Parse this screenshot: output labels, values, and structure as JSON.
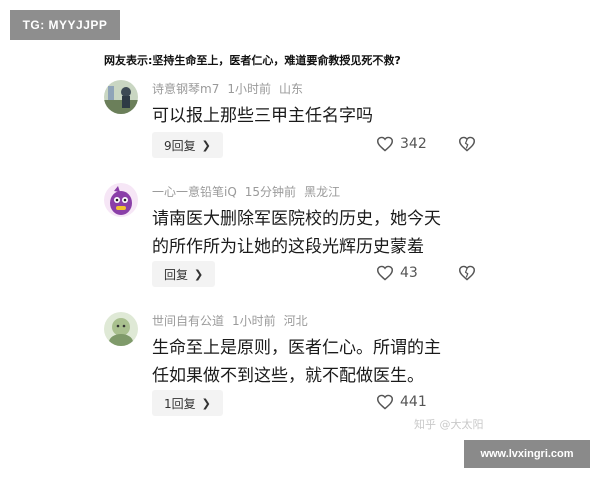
{
  "watermark_tg": "TG: MYYJJPP",
  "headline": "网友表示:坚持生命至上，医者仁心，难道要俞教授见死不救?",
  "comments": [
    {
      "username": "诗意钢琴m7",
      "time": "1小时前",
      "location": "山东",
      "text": "可以报上那些三甲主任名字吗",
      "reply_label": "9回复",
      "likes": "342"
    },
    {
      "username": "一心一意铅笔iQ",
      "time": "15分钟前",
      "location": "黑龙江",
      "text": "请南医大删除军医院校的历史，她今天\n的所作所为让她的这段光辉历史蒙羞",
      "reply_label": "回复",
      "likes": "43"
    },
    {
      "username": "世间自有公道",
      "time": "1小时前",
      "location": "河北",
      "text": "生命至上是原则，医者仁心。所谓的主\n任如果做不到这些，就不配做医生。",
      "reply_label": "1回复",
      "likes": "441"
    }
  ],
  "watermark_zhihu": "知乎 @大太阳",
  "watermark_url": "www.lvxingri.com",
  "icons": {
    "reply_chevron": "chevron-right-icon",
    "like": "heart-icon",
    "dislike": "broken-heart-icon"
  },
  "colors": {
    "meta": "#9a9a9a",
    "badge": "#8e8e8e",
    "reply_bg": "#f3f3f3"
  }
}
